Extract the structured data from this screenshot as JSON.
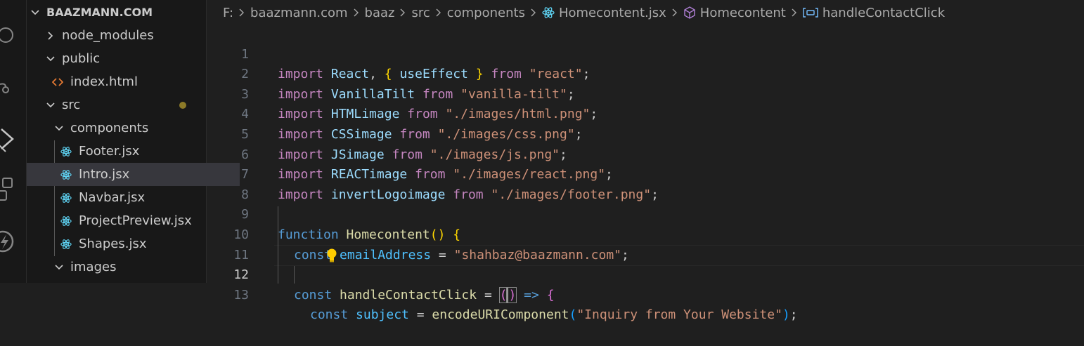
{
  "explorer": {
    "root_label": "BAAZMANN.COM",
    "items": [
      {
        "label": "node_modules",
        "kind": "folder",
        "expanded": false
      },
      {
        "label": "public",
        "kind": "folder",
        "expanded": true
      },
      {
        "label": "index.html",
        "kind": "html-file"
      },
      {
        "label": "src",
        "kind": "folder",
        "expanded": true,
        "modified": true
      },
      {
        "label": "components",
        "kind": "folder",
        "expanded": true
      },
      {
        "label": "Footer.jsx",
        "kind": "react-file"
      },
      {
        "label": "Intro.jsx",
        "kind": "react-file",
        "selected": true
      },
      {
        "label": "Navbar.jsx",
        "kind": "react-file"
      },
      {
        "label": "ProjectPreview.jsx",
        "kind": "react-file"
      },
      {
        "label": "Shapes.jsx",
        "kind": "react-file"
      },
      {
        "label": "images",
        "kind": "folder",
        "expanded": true
      }
    ]
  },
  "breadcrumb": {
    "drive": "F:",
    "parts": [
      "baazmann.com",
      "baaz",
      "src",
      "components"
    ],
    "file": "Homecontent.jsx",
    "component": "Homecontent",
    "symbol": "handleContactClick"
  },
  "editor": {
    "line_numbers": [
      "1",
      "2",
      "3",
      "4",
      "5",
      "6",
      "7",
      "8",
      "9",
      "10",
      "11",
      "12",
      "13"
    ],
    "active_line": "12",
    "lightbulb_icon": "lightbulb-icon",
    "code": {
      "import_kw": "import",
      "from_kw": "from",
      "l1_react": "React",
      "l1_use_effect": "useEffect",
      "l1_src": "\"react\"",
      "l2_name": "VanillaTilt",
      "l2_src": "\"vanilla-tilt\"",
      "l3_name": "HTMLimage",
      "l3_src": "\"./images/html.png\"",
      "l4_name": "CSSimage",
      "l4_src": "\"./images/css.png\"",
      "l5_name": "JSimage",
      "l5_src": "\"./images/js.png\"",
      "l6_name": "REACTimage",
      "l6_src": "\"./images/react.png\"",
      "l7_name": "invertLogoimage",
      "l7_src": "\"./images/footer.png\"",
      "function_kw": "function",
      "l9_name": "Homecontent",
      "const_kw": "const",
      "l10_name": "emailAddress",
      "l10_value": "\"shahbaz@baazmann.com\"",
      "l12_name": "handleContactClick",
      "l13_name": "subject",
      "l13_fn": "encodeURIComponent",
      "l13_arg": "\"Inquiry from Your Website\""
    }
  },
  "colors": {
    "editor_bg": "#1f1f1f",
    "sidebar_bg": "#181818",
    "keyword_control": "#c586c0",
    "variable": "#9cdcfe",
    "string": "#ce9178",
    "keyword_storage": "#569cd6",
    "constant": "#4fc1ff",
    "function": "#dcdcaa"
  }
}
